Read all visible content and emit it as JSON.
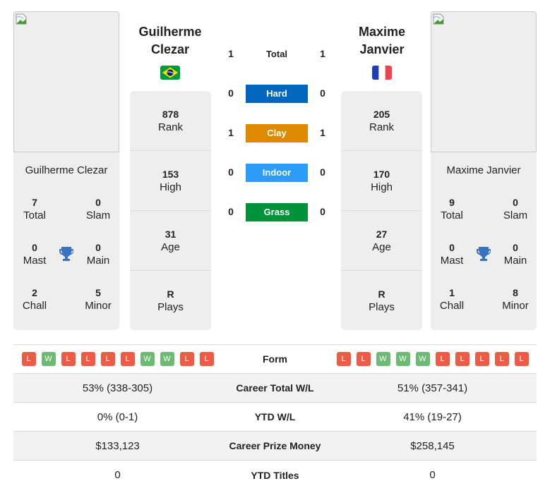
{
  "player_left": {
    "name_line1": "Guilherme",
    "name_line2": "Clezar",
    "full_name": "Guilherme Clezar",
    "country": "Brazil",
    "flag_icon": "brazil-flag-icon",
    "rank": "878",
    "rank_label": "Rank",
    "high": "153",
    "high_label": "High",
    "age": "31",
    "age_label": "Age",
    "plays": "R",
    "plays_label": "Plays",
    "titles": {
      "total": "7",
      "total_label": "Total",
      "slam": "0",
      "slam_label": "Slam",
      "mast": "0",
      "mast_label": "Mast",
      "main": "0",
      "main_label": "Main",
      "chall": "2",
      "chall_label": "Chall",
      "minor": "5",
      "minor_label": "Minor"
    },
    "form": [
      "L",
      "W",
      "L",
      "L",
      "L",
      "L",
      "W",
      "W",
      "L",
      "L"
    ]
  },
  "player_right": {
    "name_line1": "Maxime",
    "name_line2": "Janvier",
    "full_name": "Maxime Janvier",
    "country": "France",
    "flag_icon": "france-flag-icon",
    "rank": "205",
    "rank_label": "Rank",
    "high": "170",
    "high_label": "High",
    "age": "27",
    "age_label": "Age",
    "plays": "R",
    "plays_label": "Plays",
    "titles": {
      "total": "9",
      "total_label": "Total",
      "slam": "0",
      "slam_label": "Slam",
      "mast": "0",
      "mast_label": "Mast",
      "main": "0",
      "main_label": "Main",
      "chall": "1",
      "chall_label": "Chall",
      "minor": "8",
      "minor_label": "Minor"
    },
    "form": [
      "L",
      "L",
      "W",
      "W",
      "W",
      "L",
      "L",
      "L",
      "L",
      "L"
    ]
  },
  "h2h": [
    {
      "label": "Total",
      "left": "1",
      "right": "1",
      "color": ""
    },
    {
      "label": "Hard",
      "left": "0",
      "right": "0",
      "color": "#0066bf"
    },
    {
      "label": "Clay",
      "left": "1",
      "right": "1",
      "color": "#dd8a00"
    },
    {
      "label": "Indoor",
      "left": "0",
      "right": "0",
      "color": "#2c9cf6"
    },
    {
      "label": "Grass",
      "left": "0",
      "right": "0",
      "color": "#00933a"
    }
  ],
  "comparison": {
    "form_label": "Form",
    "rows": [
      {
        "label": "Career Total W/L",
        "left": "53% (338-305)",
        "right": "51% (357-341)"
      },
      {
        "label": "YTD W/L",
        "left": "0% (0-1)",
        "right": "41% (19-27)"
      },
      {
        "label": "Career Prize Money",
        "left": "$133,123",
        "right": "$258,145"
      },
      {
        "label": "YTD Titles",
        "left": "0",
        "right": "0"
      }
    ]
  },
  "colors": {
    "loss": "#ee5b45",
    "win": "#6dbb72",
    "trophy": "#3b72c0"
  }
}
